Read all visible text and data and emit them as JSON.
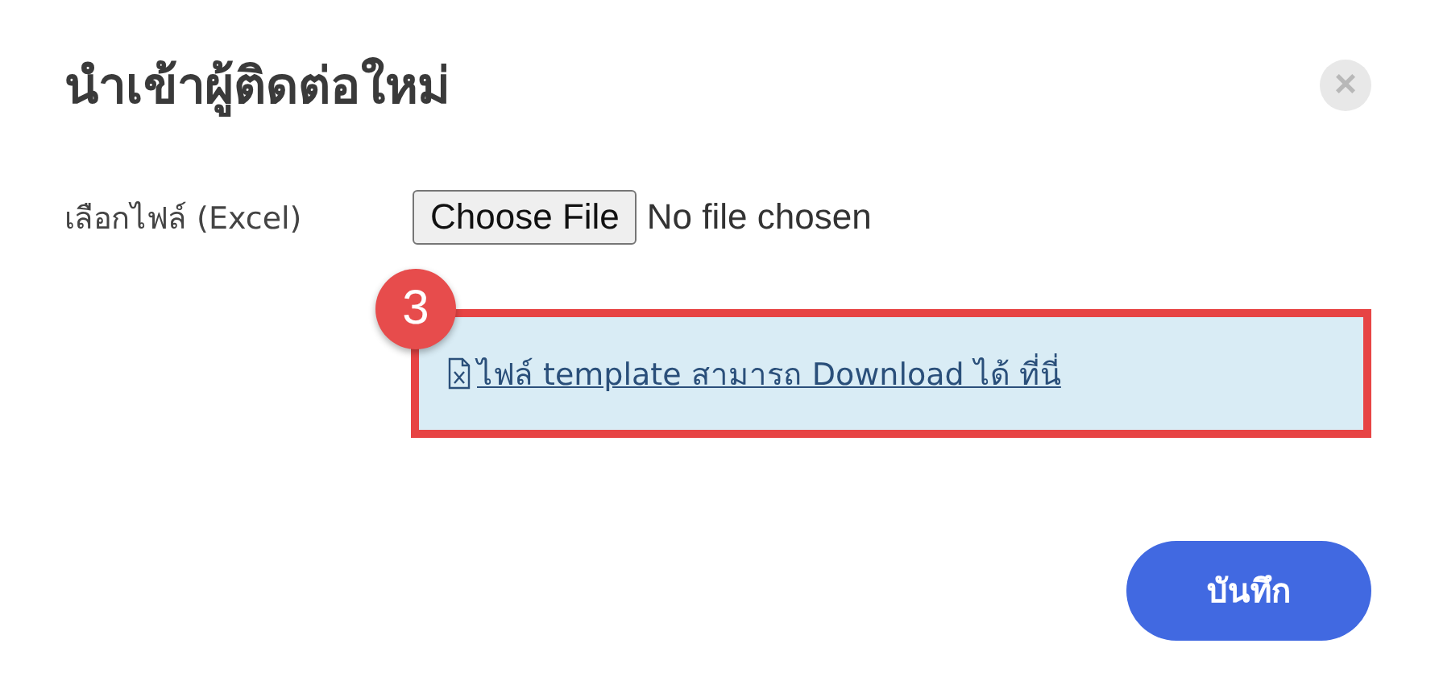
{
  "dialog": {
    "title": "นำเข้าผู้ติดต่อใหม่",
    "close": "×"
  },
  "file_field": {
    "label": "เลือกไฟล์ (Excel)",
    "button": "Choose File",
    "status": "No file chosen"
  },
  "callout": {
    "step": "3",
    "link": "ไฟล์ template สามารถ Download ได้ ที่นี่"
  },
  "buttons": [
    {
      "label": "บันทึก",
      "kind": "primary"
    }
  ]
}
